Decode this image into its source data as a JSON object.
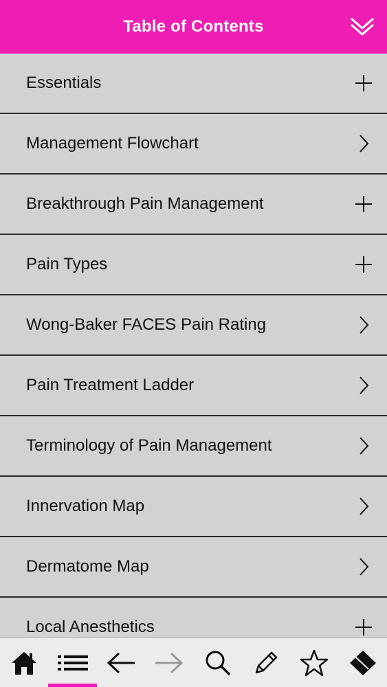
{
  "header": {
    "title": "Table of Contents",
    "collapse_icon": "double-chevron-down-icon",
    "background": "#ee1eb4"
  },
  "toc": {
    "items": [
      {
        "label": "Essentials",
        "icon": "plus"
      },
      {
        "label": "Management Flowchart",
        "icon": "chevron-right"
      },
      {
        "label": "Breakthrough Pain Management",
        "icon": "plus"
      },
      {
        "label": "Pain Types",
        "icon": "plus"
      },
      {
        "label": "Wong-Baker FACES Pain Rating",
        "icon": "chevron-right"
      },
      {
        "label": "Pain Treatment Ladder",
        "icon": "chevron-right"
      },
      {
        "label": "Terminology of Pain Management",
        "icon": "chevron-right"
      },
      {
        "label": "Innervation Map",
        "icon": "chevron-right"
      },
      {
        "label": "Dermatome Map",
        "icon": "chevron-right"
      },
      {
        "label": "Local Anesthetics",
        "icon": "plus"
      }
    ]
  },
  "tabbar": {
    "tabs": [
      {
        "icon": "home-icon",
        "active": false,
        "enabled": true
      },
      {
        "icon": "list-icon",
        "active": true,
        "enabled": true
      },
      {
        "icon": "back-arrow-icon",
        "active": false,
        "enabled": true
      },
      {
        "icon": "forward-arrow-icon",
        "active": false,
        "enabled": false
      },
      {
        "icon": "search-icon",
        "active": false,
        "enabled": true
      },
      {
        "icon": "pencil-icon",
        "active": false,
        "enabled": true
      },
      {
        "icon": "star-icon",
        "active": false,
        "enabled": true
      },
      {
        "icon": "eraser-icon",
        "active": false,
        "enabled": true
      }
    ],
    "active_color": "#ee1eb4"
  }
}
